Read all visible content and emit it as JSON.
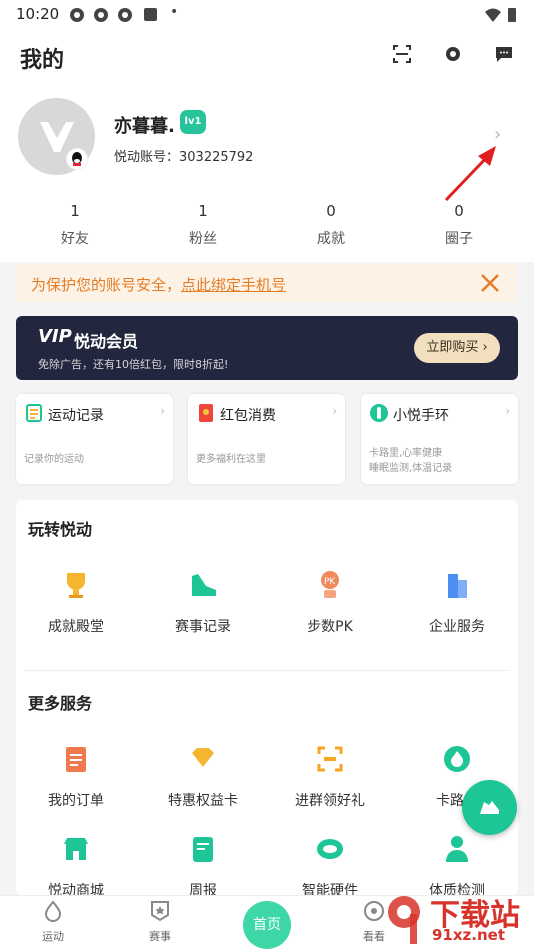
{
  "status": {
    "time": "10:20"
  },
  "header": {
    "title": "我的"
  },
  "profile": {
    "username": "亦暮暮.",
    "level": "lv1",
    "account_label": "悦动账号：303225792",
    "stats": [
      {
        "value": "1",
        "label": "好友"
      },
      {
        "value": "1",
        "label": "粉丝"
      },
      {
        "value": "0",
        "label": "成就"
      },
      {
        "value": "0",
        "label": "圈子"
      }
    ]
  },
  "notice": {
    "prefix": "为保护您的账号安全，",
    "link": "点此绑定手机号"
  },
  "vip": {
    "logo": "VIP",
    "title": "悦动会员",
    "subtitle": "免除广告，还有10倍红包，限时8折起!",
    "button": "立即购买 ›"
  },
  "cards": [
    {
      "title": "运动记录",
      "desc": "记录你的运动"
    },
    {
      "title": "红包消费",
      "desc": "更多福利在这里"
    },
    {
      "title": "小悦手环",
      "desc": "卡路里,心率健康\n睡眠监测,体温记录"
    }
  ],
  "fun": {
    "title": "玩转悦动",
    "items": [
      {
        "label": "成就殿堂",
        "icon": "trophy-icon"
      },
      {
        "label": "赛事记录",
        "icon": "shoe-icon"
      },
      {
        "label": "步数PK",
        "icon": "pk-icon"
      },
      {
        "label": "企业服务",
        "icon": "building-icon"
      }
    ]
  },
  "more": {
    "title": "更多服务",
    "items": [
      {
        "label": "我的订单",
        "icon": "order-icon"
      },
      {
        "label": "特惠权益卡",
        "icon": "diamond-icon"
      },
      {
        "label": "进群领好礼",
        "icon": "scan-group-icon"
      },
      {
        "label": "卡路里",
        "icon": "flame-icon"
      },
      {
        "label": "悦动商城",
        "icon": "shop-icon"
      },
      {
        "label": "周报",
        "icon": "report-icon"
      },
      {
        "label": "智能硬件",
        "icon": "band-icon"
      },
      {
        "label": "体质检测",
        "icon": "doctor-icon"
      }
    ]
  },
  "tabs": [
    {
      "label": "运动"
    },
    {
      "label": "赛事"
    },
    {
      "label": "首页"
    },
    {
      "label": "看看"
    }
  ],
  "watermark": {
    "big": "下载站",
    "small": "91xz.net"
  },
  "colors": {
    "accent": "#1ec596",
    "notice": "#e57c26",
    "vip_bg": "#22263e",
    "watermark": "#d8332b"
  }
}
